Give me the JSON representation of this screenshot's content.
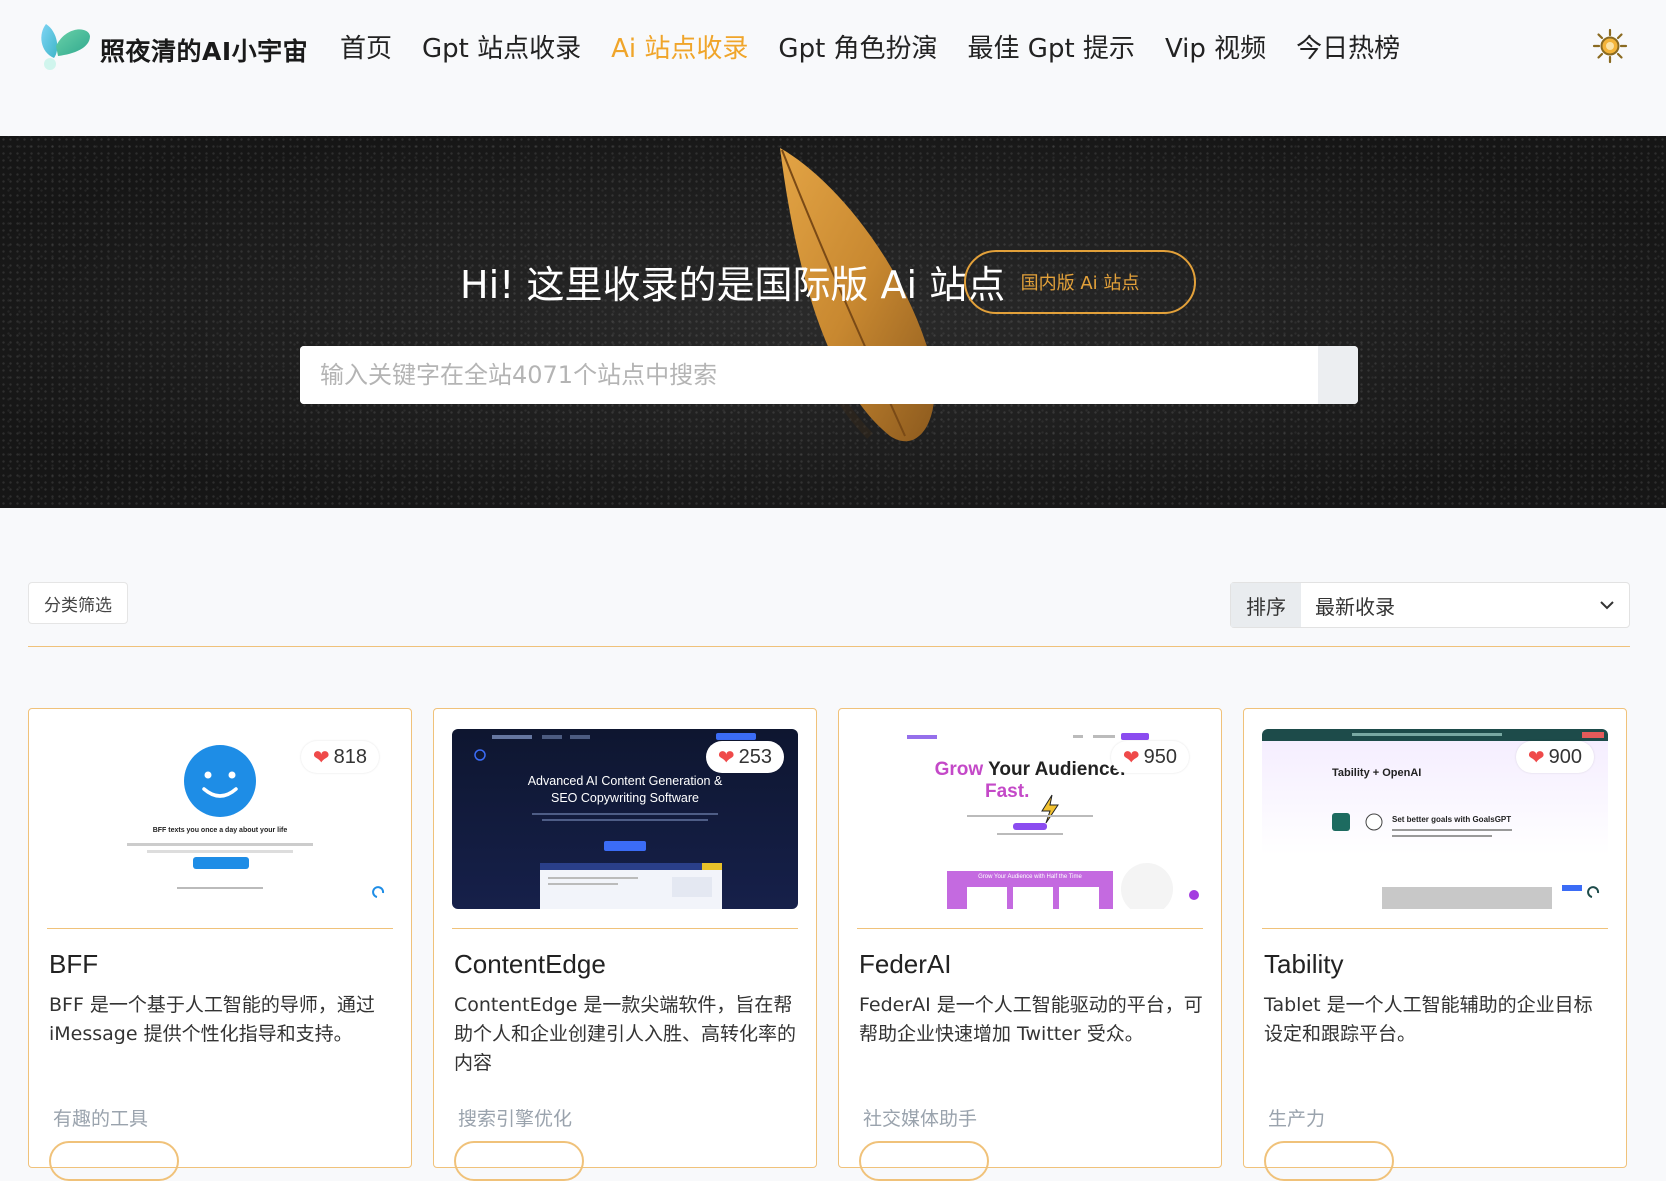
{
  "brand": {
    "name": "照夜清的AI小宇宙"
  },
  "nav": {
    "items": [
      {
        "label": "首页"
      },
      {
        "label": "Gpt 站点收录"
      },
      {
        "label": "Ai 站点收录"
      },
      {
        "label": "Gpt 角色扮演"
      },
      {
        "label": "最佳 Gpt 提示"
      },
      {
        "label": "Vip 视频"
      },
      {
        "label": "今日热榜"
      }
    ],
    "active_index": 2
  },
  "hero": {
    "title": "Hi! 这里收录的是国际版 Ai 站点",
    "cn_button": "国内版 Ai 站点",
    "search_placeholder": "输入关键字在全站4071个站点中搜索"
  },
  "filter": {
    "category_button": "分类筛选",
    "sort_label": "排序",
    "sort_value": "最新收录"
  },
  "cards": [
    {
      "title": "BFF",
      "likes": "818",
      "description": "BFF 是一个基于人工智能的导师，通过 iMessage 提供个性化指导和支持。",
      "category": "有趣的工具",
      "thumb_text": "BFF texts you once a day about your life"
    },
    {
      "title": "ContentEdge",
      "likes": "253",
      "description": "ContentEdge 是一款尖端软件，旨在帮助个人和企业创建引人入胜、高转化率的内容",
      "category": "搜索引擎优化",
      "thumb_text": "Advanced AI Content Generation & SEO Copywriting Software"
    },
    {
      "title": "FederAI",
      "likes": "950",
      "description": "FederAI 是一个人工智能驱动的平台，可帮助企业快速增加 Twitter 受众。",
      "category": "社交媒体助手",
      "thumb_text_1": "Grow",
      "thumb_text_2": "Your Audience.",
      "thumb_text_3": "Fast.",
      "thumb_text_4": "Grow Your Audience with Half the Time"
    },
    {
      "title": "Tability",
      "likes": "900",
      "description": "Tablet 是一个人工智能辅助的企业目标设定和跟踪平台。",
      "category": "生产力",
      "thumb_text_1": "Tability + OpenAI",
      "thumb_text_2": "Set better goals with GoalsGPT"
    }
  ],
  "colors": {
    "accent": "#f0a52a",
    "card_border": "#f0c27a",
    "heart": "#ef4a4a"
  }
}
